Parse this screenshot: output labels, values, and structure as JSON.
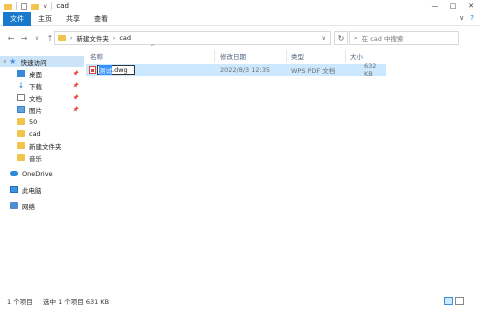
{
  "window": {
    "title": "cad",
    "controls": [
      "—",
      "□",
      "✕"
    ]
  },
  "ribbon": {
    "tabs": [
      "文件",
      "主页",
      "共享",
      "查看"
    ],
    "right_icons": [
      "chevron-down-icon",
      "help-icon"
    ]
  },
  "address": {
    "back": "←",
    "forward": "→",
    "dropdown": "∨",
    "up": "↑",
    "path": [
      "新建文件夹",
      "cad"
    ],
    "search_placeholder": "在 cad 中搜索"
  },
  "nav_pane": {
    "items": [
      {
        "label": "快速访问",
        "icon": "star-icon",
        "pinned": false
      },
      {
        "label": "桌面",
        "icon": "desktop-icon",
        "pinned": true
      },
      {
        "label": "下载",
        "icon": "download-icon",
        "pinned": true
      },
      {
        "label": "文档",
        "icon": "document-icon",
        "pinned": true
      },
      {
        "label": "图片",
        "icon": "picture-icon",
        "pinned": true
      },
      {
        "label": "50",
        "icon": "folder-icon",
        "pinned": false
      },
      {
        "label": "cad",
        "icon": "folder-icon",
        "pinned": false
      },
      {
        "label": "新建文件夹",
        "icon": "folder-icon",
        "pinned": false
      },
      {
        "label": "音乐",
        "icon": "folder-icon",
        "pinned": false
      },
      {
        "label": "OneDrive",
        "icon": "cloud-icon",
        "pinned": false
      },
      {
        "label": "此电脑",
        "icon": "computer-icon",
        "pinned": false
      },
      {
        "label": "网络",
        "icon": "network-icon",
        "pinned": false
      }
    ]
  },
  "columns": {
    "name": "名称",
    "modified": "修改日期",
    "type": "类型",
    "size": "大小"
  },
  "files": [
    {
      "name_selected": "测试",
      "name_ext": ".dwg",
      "modified": "2022/8/3 12:35",
      "type": "WPS PDF 文档",
      "size": "632 KB"
    }
  ],
  "status": {
    "count": "1 个项目",
    "selected": "选中 1 个项目 631 KB"
  },
  "colors": {
    "accent": "#1979ca",
    "selection": "#cce8ff",
    "folder": "#f2c44d"
  }
}
